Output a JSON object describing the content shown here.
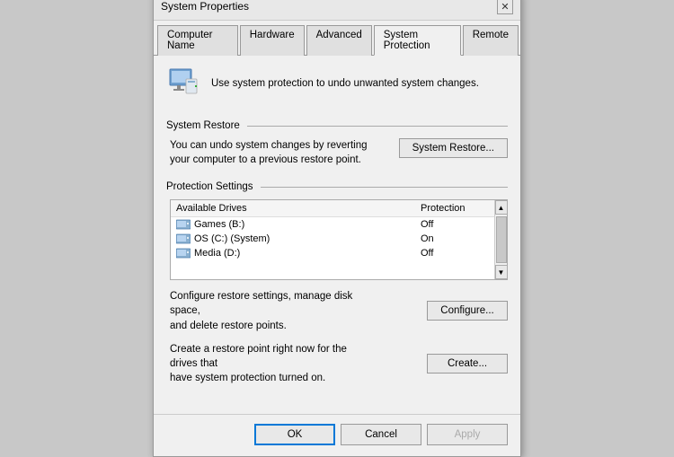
{
  "dialog": {
    "title": "System Properties",
    "close_label": "✕"
  },
  "tabs": [
    {
      "label": "Computer Name",
      "active": false
    },
    {
      "label": "Hardware",
      "active": false
    },
    {
      "label": "Advanced",
      "active": false
    },
    {
      "label": "System Protection",
      "active": true
    },
    {
      "label": "Remote",
      "active": false
    }
  ],
  "intro": {
    "text": "Use system protection to undo unwanted system changes."
  },
  "system_restore_section": {
    "label": "System Restore",
    "desc": "You can undo system changes by reverting\nyour computer to a previous restore point.",
    "button": "System Restore..."
  },
  "protection_section": {
    "label": "Protection Settings",
    "table": {
      "col_drives": "Available Drives",
      "col_protection": "Protection",
      "rows": [
        {
          "name": "Games (B:)",
          "protection": "Off"
        },
        {
          "name": "OS (C:) (System)",
          "protection": "On"
        },
        {
          "name": "Media (D:)",
          "protection": "Off"
        }
      ]
    }
  },
  "configure_section": {
    "desc": "Configure restore settings, manage disk space,\nand delete restore points.",
    "button": "Configure..."
  },
  "create_section": {
    "desc": "Create a restore point right now for the drives that\nhave system protection turned on.",
    "button": "Create..."
  },
  "footer": {
    "ok": "OK",
    "cancel": "Cancel",
    "apply": "Apply"
  },
  "icons": {
    "computer": "💻",
    "drive": "🖥",
    "scroll_up": "▲",
    "scroll_down": "▼"
  }
}
